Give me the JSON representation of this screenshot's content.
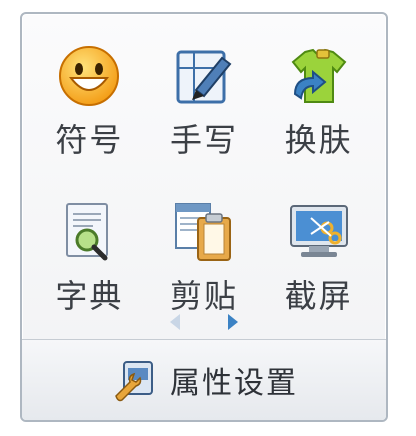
{
  "tools": {
    "symbols": {
      "label": "符号",
      "icon": "smiley-face-icon"
    },
    "handwriting": {
      "label": "手写",
      "icon": "pen-on-paper-icon"
    },
    "skin": {
      "label": "换肤",
      "icon": "shirt-swap-icon"
    },
    "dictionary": {
      "label": "字典",
      "icon": "document-magnifier-icon"
    },
    "clipboard": {
      "label": "剪贴",
      "icon": "clipboard-icon"
    },
    "screenshot": {
      "label": "截屏",
      "icon": "monitor-scissors-icon"
    }
  },
  "pager": {
    "prev_icon": "arrow-left-icon",
    "next_icon": "arrow-right-icon"
  },
  "footer": {
    "label": "属性设置",
    "icon": "settings-wrench-icon"
  },
  "colors": {
    "accent": "#3b82c4",
    "arrow_inactive": "#c9d6e6",
    "arrow_active": "#3b82c4"
  }
}
